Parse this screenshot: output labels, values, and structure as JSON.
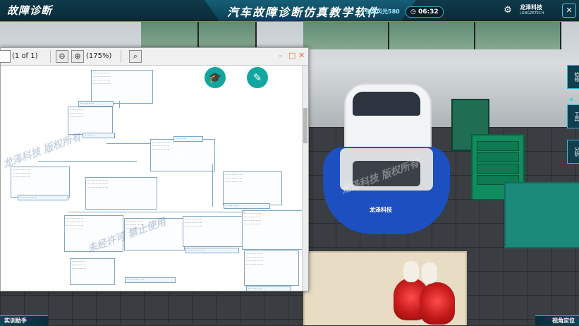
{
  "header": {
    "left_title": "故障诊断",
    "center_title": "汽车故障诊断仿真教学软件",
    "car_model": "东风风光580",
    "clock": "06:32",
    "settings_icon": "gear-icon",
    "brand_name": "龙泽科技",
    "brand_sub": "LONGZETECH",
    "close_icon": "close-icon"
  },
  "viewer": {
    "page_input": "",
    "page_count": "(1 of 1)",
    "zoom": "(175%)",
    "zoom_out_icon": "zoom-out-icon",
    "zoom_in_icon": "zoom-in-icon",
    "find_icon": "binoculars-icon",
    "minimize": "–",
    "maximize": "□",
    "close": "✕"
  },
  "fab": {
    "course_icon": "graduation-cap-icon",
    "tool_icon": "screwdriver-icon"
  },
  "side_panel": {
    "items": [
      "检修",
      "工具",
      "分析"
    ]
  },
  "bottom": {
    "left_button": "实训助手",
    "right_button": "视角定位"
  },
  "car": {
    "cover_text": "龙泽科技"
  },
  "watermark": {
    "text": "龙泽科技 版权所有",
    "text2": "未经许可 禁止使用"
  },
  "colors": {
    "header_bg": "#0a2a36",
    "accent": "#2fa7c8",
    "fab_teal": "#12a6a0",
    "cover_blue": "#1c4fbf",
    "cabinet_green": "#118c5e"
  }
}
